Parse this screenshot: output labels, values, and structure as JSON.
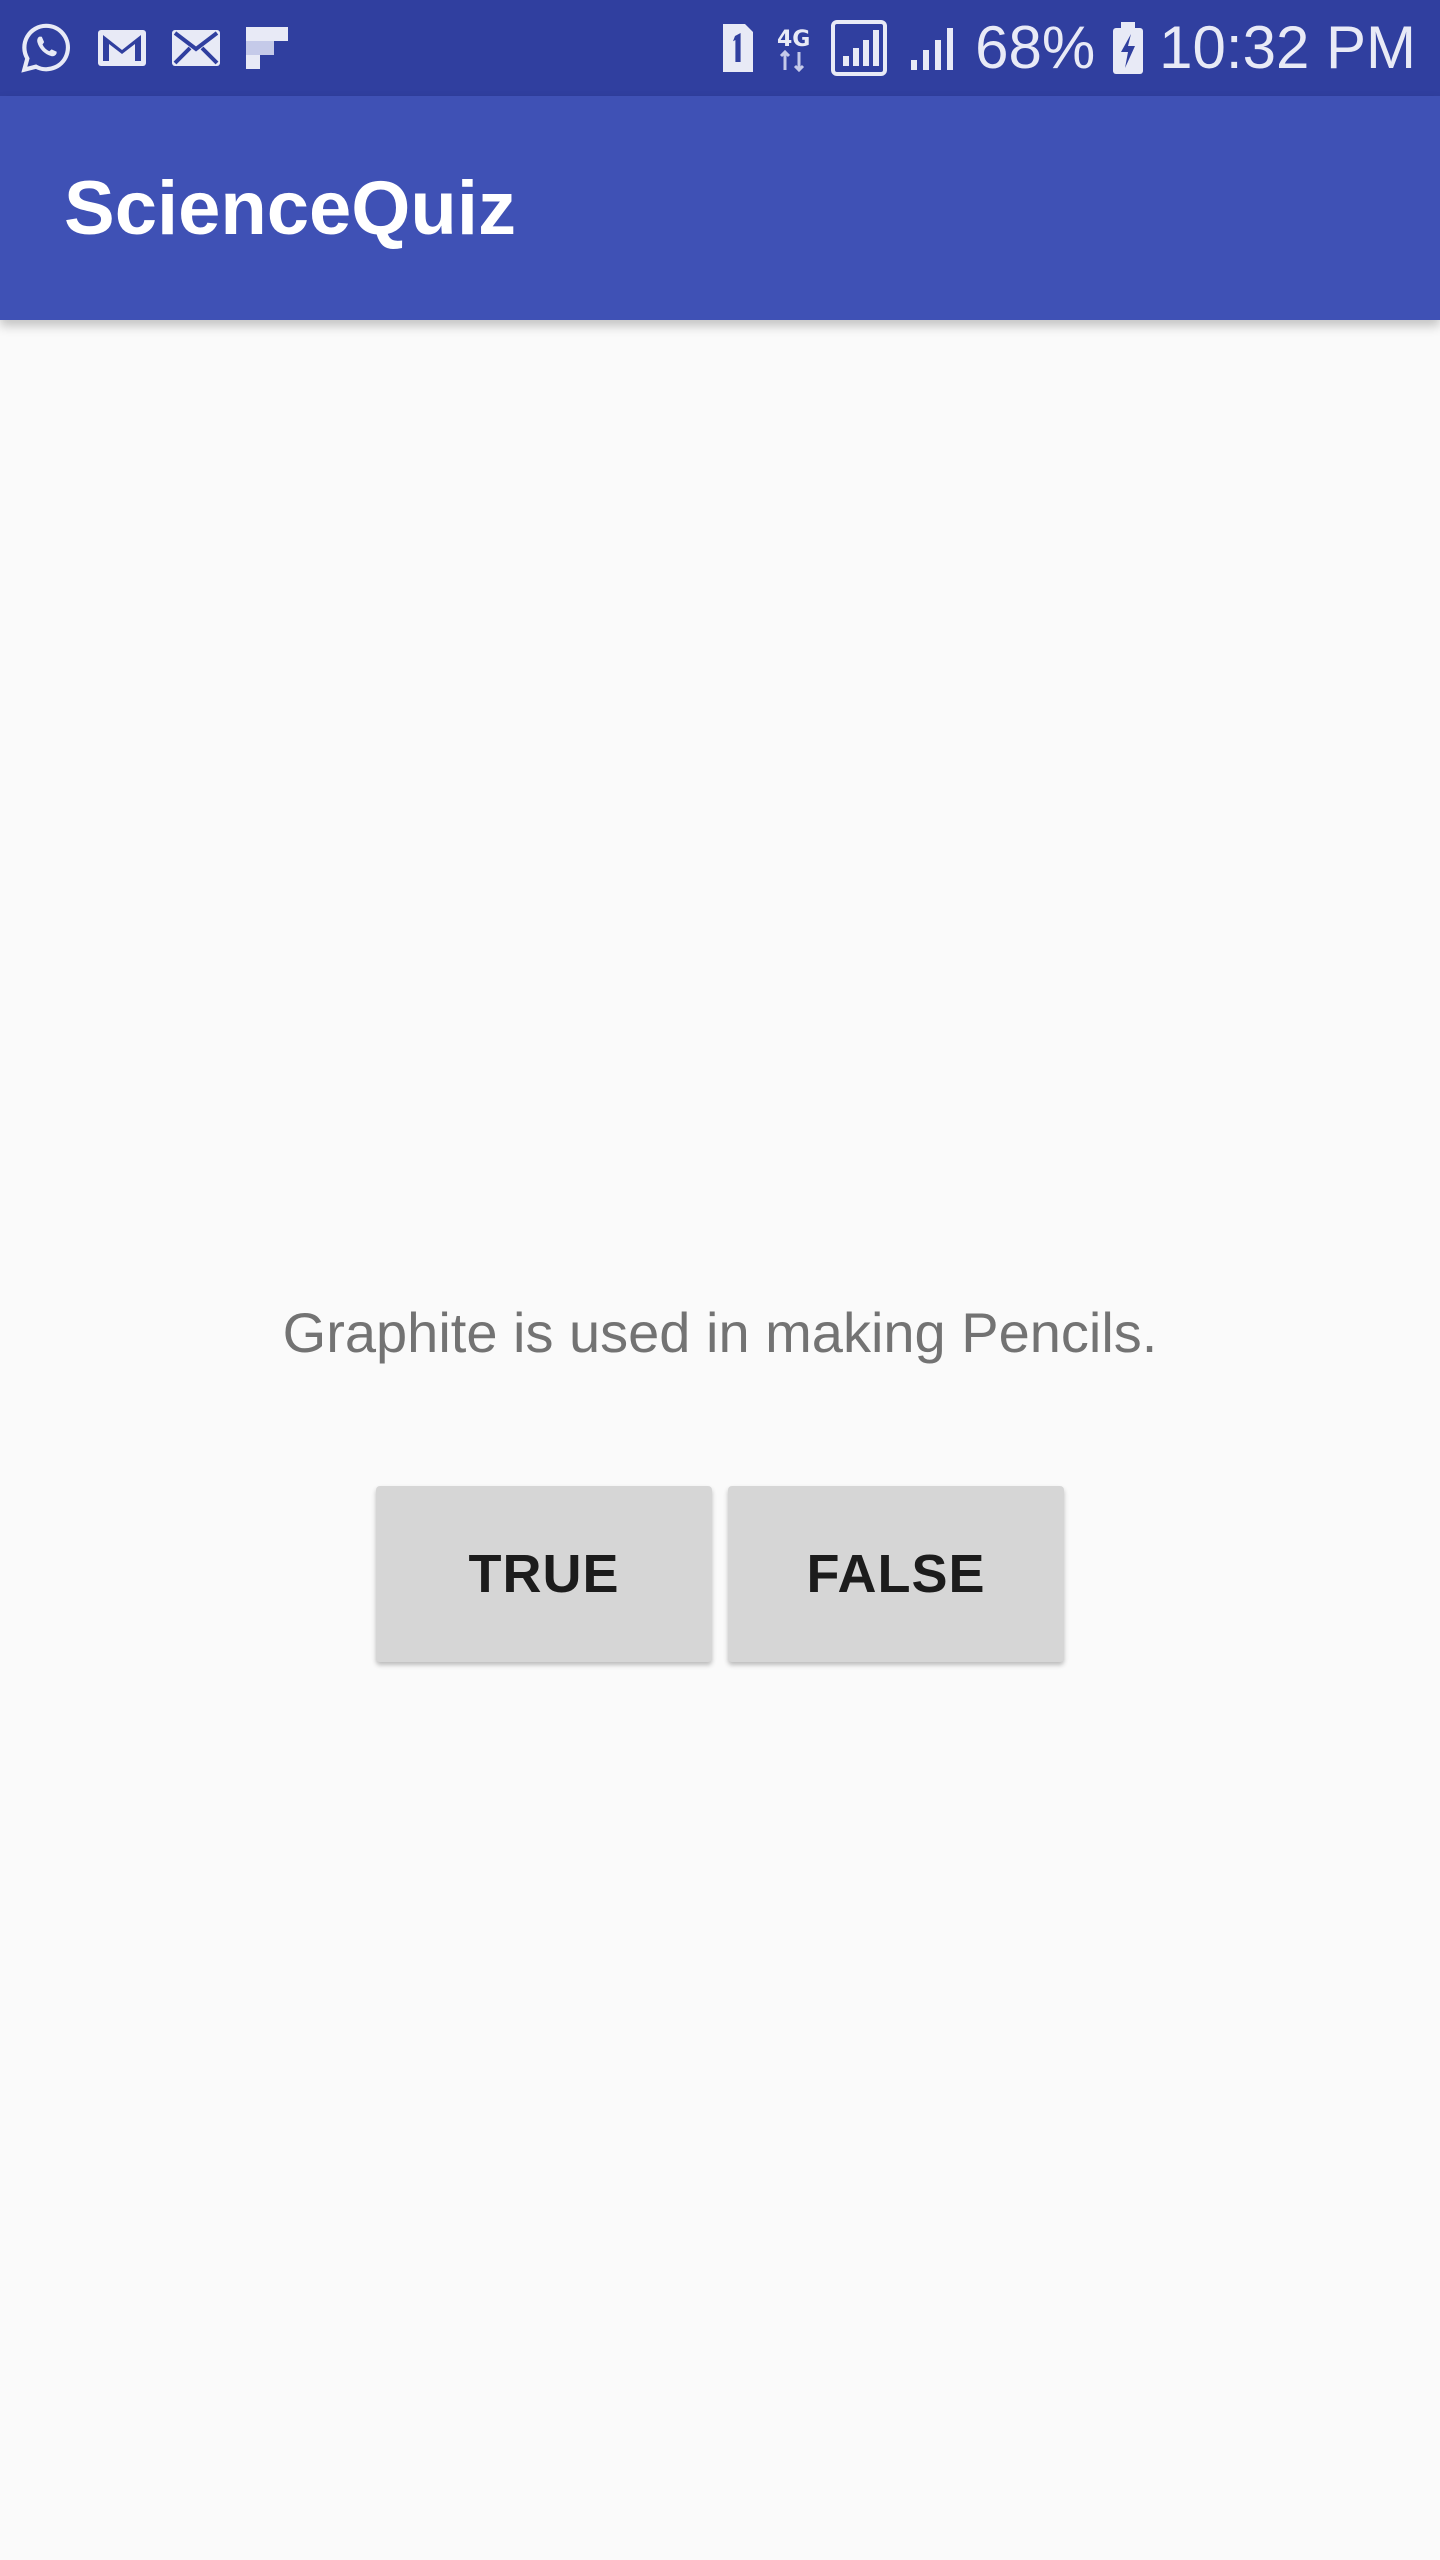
{
  "status_bar": {
    "left_icons": [
      "whatsapp-icon",
      "gmail-icon",
      "email-icon",
      "flipboard-icon"
    ],
    "right_icons": [
      "sim-1-icon",
      "4g-data-icon",
      "signal-sim1-icon",
      "signal-sim2-icon"
    ],
    "battery_percent": "68%",
    "battery_icon": "battery-charging-icon",
    "time": "10:32 PM",
    "color": "#303f9f"
  },
  "app_bar": {
    "title": "ScienceQuiz",
    "color": "#3f51b5"
  },
  "quiz": {
    "question": "Graphite is used in making Pencils.",
    "true_label": "TRUE",
    "false_label": "FALSE"
  }
}
